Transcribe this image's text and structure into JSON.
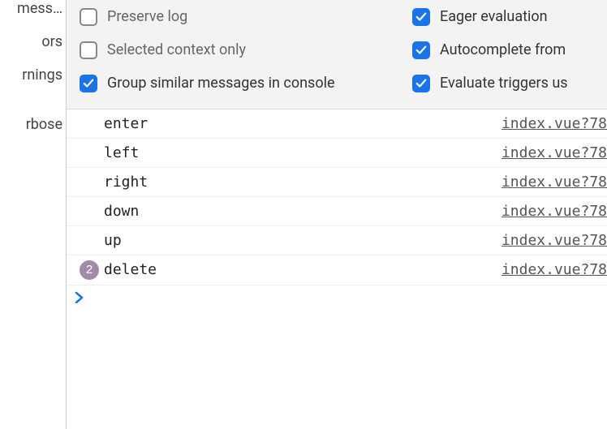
{
  "sidebar": {
    "items": [
      {
        "label": "mess…"
      },
      {
        "label": "ors"
      },
      {
        "label": "rnings"
      },
      {
        "label": ""
      },
      {
        "label": "rbose"
      }
    ]
  },
  "settings": {
    "left": [
      {
        "checked": false,
        "label": "Preserve log",
        "wrap": false
      },
      {
        "checked": false,
        "label": "Selected context only",
        "wrap": false
      },
      {
        "checked": true,
        "label": "Group similar messages in console",
        "wrap": true
      }
    ],
    "right": [
      {
        "checked": true,
        "label": "Eager evaluation"
      },
      {
        "checked": true,
        "label": "Autocomplete from"
      },
      {
        "checked": true,
        "label": "Evaluate triggers us"
      }
    ]
  },
  "console": {
    "rows": [
      {
        "msg": "enter",
        "source": "index.vue?78",
        "count": null
      },
      {
        "msg": "left",
        "source": "index.vue?78",
        "count": null
      },
      {
        "msg": "right",
        "source": "index.vue?78",
        "count": null
      },
      {
        "msg": "down",
        "source": "index.vue?78",
        "count": null
      },
      {
        "msg": "up",
        "source": "index.vue?78",
        "count": null
      },
      {
        "msg": "delete",
        "source": "index.vue?78",
        "count": "2"
      }
    ]
  }
}
